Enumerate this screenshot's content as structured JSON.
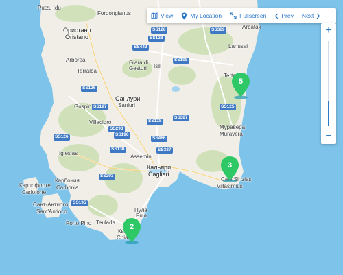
{
  "toolbar": {
    "view": "View",
    "my_location": "My Location",
    "fullscreen": "Fullscreen",
    "prev": "Prev",
    "next": "Next"
  },
  "zoom": {
    "in": "+",
    "out": "−",
    "level": 0.3
  },
  "colors": {
    "sea": "#7ec3ea",
    "land": "#f0eee7",
    "accent": "#2e78c8",
    "marker": "#2ec866",
    "road_badge": "#3f79c4"
  },
  "places": [
    {
      "id": "putzu",
      "text": "Putzu Idu"
    },
    {
      "id": "fordongianus",
      "text": "Fordongianus"
    },
    {
      "id": "oristano_cyr",
      "text": "Ористано"
    },
    {
      "id": "oristano",
      "text": "Oristano"
    },
    {
      "id": "arborea",
      "text": "Arborea"
    },
    {
      "id": "terralba",
      "text": "Terralba"
    },
    {
      "id": "giara1",
      "text": "Giara di"
    },
    {
      "id": "giara2",
      "text": "Gesturi"
    },
    {
      "id": "isili",
      "text": "Isili"
    },
    {
      "id": "arbatax",
      "text": "Arbatax"
    },
    {
      "id": "lanusei",
      "text": "Lanusei"
    },
    {
      "id": "terte",
      "text": "Terte"
    },
    {
      "id": "guspini",
      "text": "Guspini"
    },
    {
      "id": "sanluri_cyr",
      "text": "Санлури"
    },
    {
      "id": "sanluri",
      "text": "Sanluri"
    },
    {
      "id": "villacidro",
      "text": "Villacidro"
    },
    {
      "id": "muravera_cyr",
      "text": "Муравера"
    },
    {
      "id": "muravera",
      "text": "Muravera"
    },
    {
      "id": "iglesias",
      "text": "Iglesias"
    },
    {
      "id": "assemini",
      "text": "Assemini"
    },
    {
      "id": "cagliari_cyr",
      "text": "Кальяри"
    },
    {
      "id": "cagliari",
      "text": "Cagliari"
    },
    {
      "id": "carbonia_cyr",
      "text": "Карбония"
    },
    {
      "id": "carbonia",
      "text": "Carbonia"
    },
    {
      "id": "carloforte_cyr",
      "text": "Карлофорте"
    },
    {
      "id": "carloforte",
      "text": "Carloforte"
    },
    {
      "id": "santantioco_cyr",
      "text": "Сант-Антиоко"
    },
    {
      "id": "santantioco",
      "text": "Sant'Antioco"
    },
    {
      "id": "calasinzias",
      "text": "Cala Sinzias"
    },
    {
      "id": "villasimius",
      "text": "Villasimius"
    },
    {
      "id": "pula_cyr",
      "text": "Пула"
    },
    {
      "id": "pula",
      "text": "Pula"
    },
    {
      "id": "portopino",
      "text": "Porto Pino"
    },
    {
      "id": "teulada",
      "text": "Teulada"
    },
    {
      "id": "chia_cyr",
      "text": "Кья"
    },
    {
      "id": "chia",
      "text": "Chia"
    }
  ],
  "roads": [
    {
      "id": "ss128a",
      "text": "SS128"
    },
    {
      "id": "ss389",
      "text": "SS389"
    },
    {
      "id": "ss128b",
      "text": "SS128"
    },
    {
      "id": "ss442",
      "text": "SS442"
    },
    {
      "id": "ss198",
      "text": "SS198"
    },
    {
      "id": "ss126a",
      "text": "SS126"
    },
    {
      "id": "ss197",
      "text": "SS197"
    },
    {
      "id": "ss125",
      "text": "SS125"
    },
    {
      "id": "ss387a",
      "text": "SS387"
    },
    {
      "id": "ss128c",
      "text": "SS128"
    },
    {
      "id": "ss293a",
      "text": "SS293"
    },
    {
      "id": "ss196",
      "text": "SS196"
    },
    {
      "id": "ss126b",
      "text": "SS126"
    },
    {
      "id": "ss466",
      "text": "SS466"
    },
    {
      "id": "ss387b",
      "text": "SS387"
    },
    {
      "id": "ss130",
      "text": "SS130"
    },
    {
      "id": "ss293b",
      "text": "SS293"
    },
    {
      "id": "ss195",
      "text": "SS195"
    }
  ],
  "markers": [
    {
      "id": "m5",
      "label": "5"
    },
    {
      "id": "m3",
      "label": "3"
    },
    {
      "id": "m2",
      "label": "2"
    }
  ]
}
